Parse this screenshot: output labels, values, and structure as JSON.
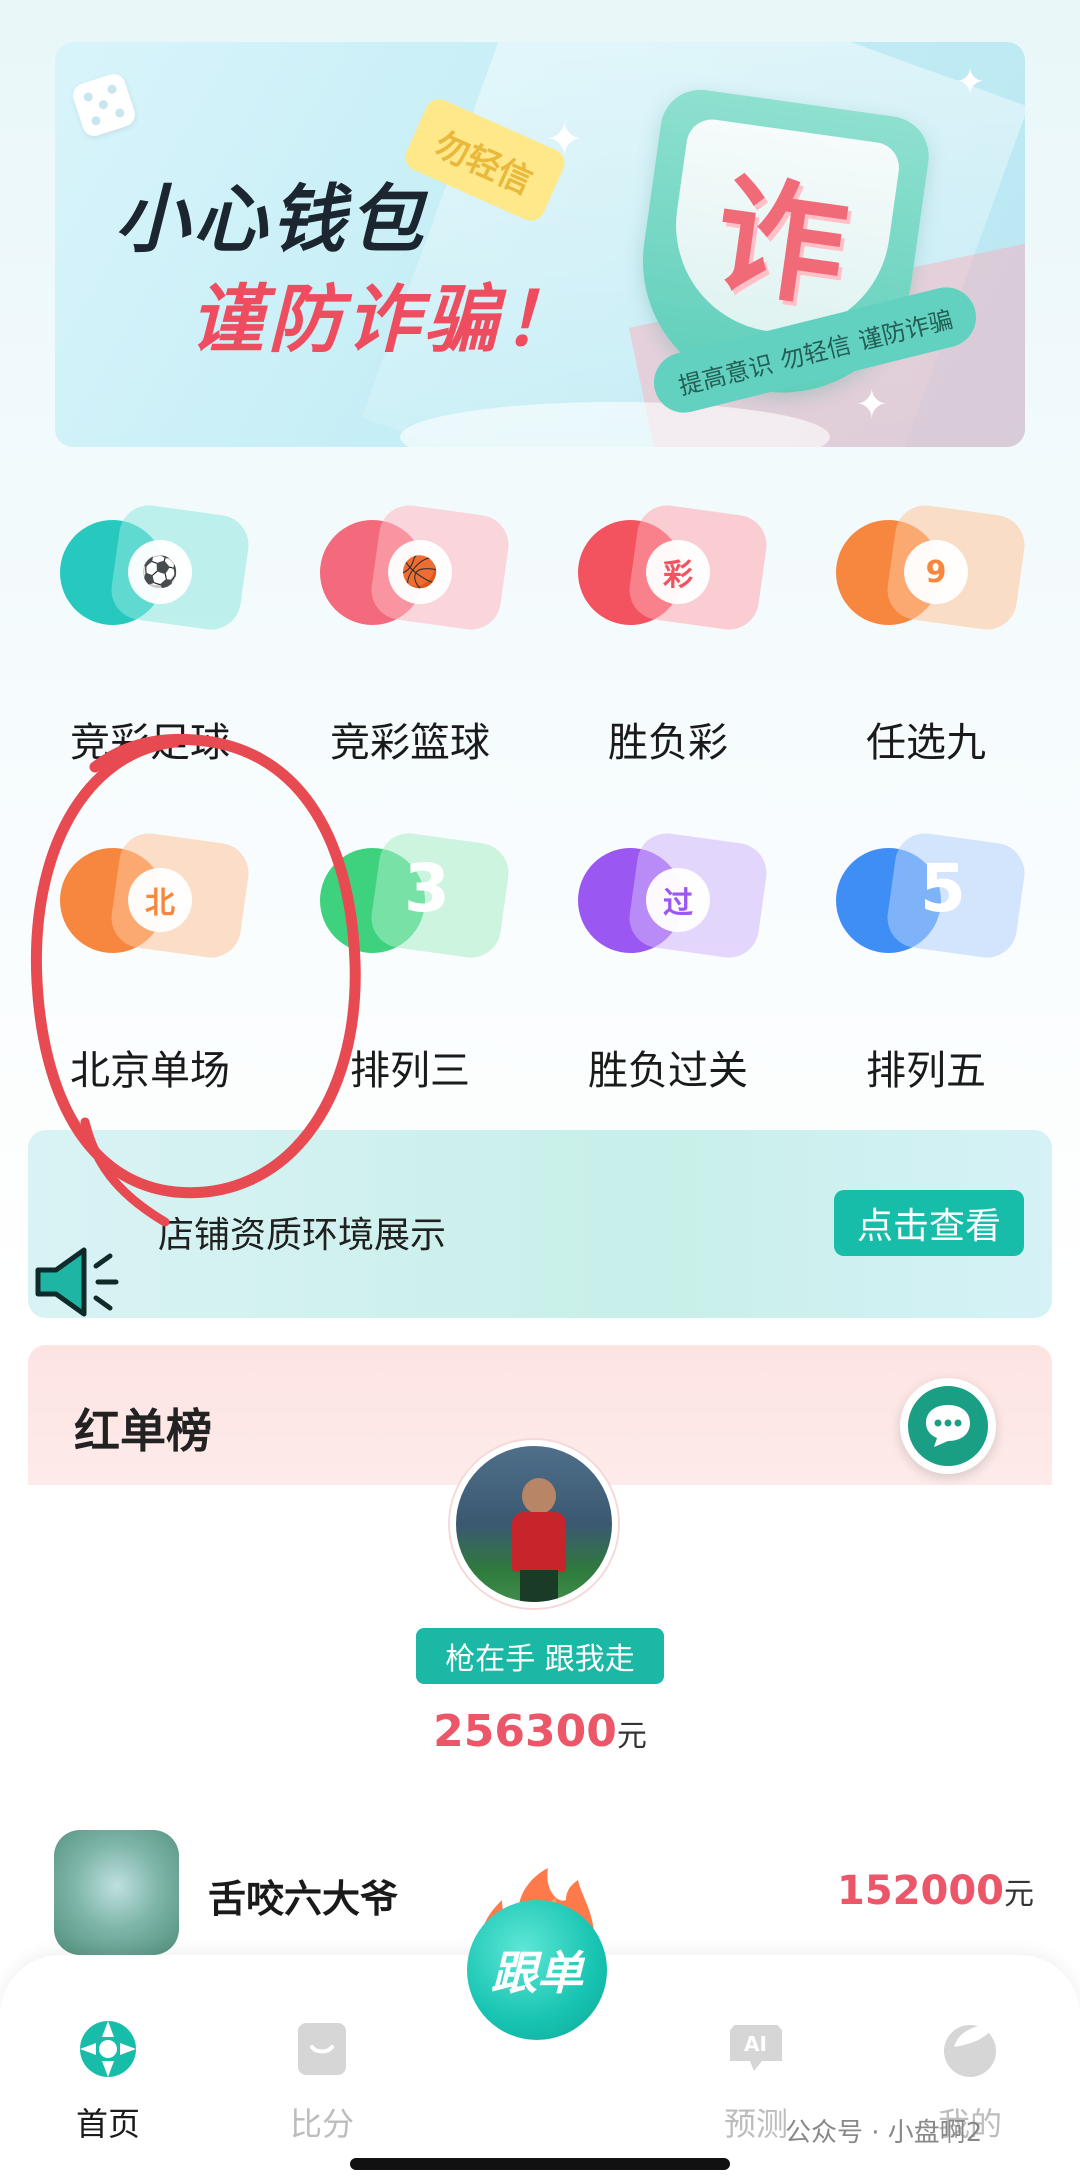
{
  "banner": {
    "title": "小心钱包",
    "subtitle": "谨防诈骗！",
    "tag": "勿轻信",
    "shield_char": "诈",
    "ribbon": [
      "提高意识",
      "勿轻信",
      "谨防诈骗"
    ]
  },
  "categories": [
    {
      "label": "竞彩足球",
      "glyph": "⚽",
      "color": "#27c9bf",
      "icon": "soccer-ball-icon"
    },
    {
      "label": "竞彩篮球",
      "glyph": "🏀",
      "color": "#f26a7b",
      "icon": "basketball-icon"
    },
    {
      "label": "胜负彩",
      "glyph": "彩",
      "color": "#f2535f",
      "icon": "cai-coin-icon"
    },
    {
      "label": "任选九",
      "glyph": "9",
      "color": "#f7863e",
      "icon": "nine-coin-icon"
    },
    {
      "label": "北京单场",
      "glyph": "北",
      "color": "#f7863e",
      "icon": "bei-ball-icon"
    },
    {
      "label": "排列三",
      "glyph": "3",
      "color": "#3fd27e",
      "icon": "three-icon"
    },
    {
      "label": "胜负过关",
      "glyph": "过",
      "color": "#9a57f2",
      "icon": "guo-ball-icon"
    },
    {
      "label": "排列五",
      "glyph": "5",
      "color": "#3e8ef5",
      "icon": "five-icon"
    }
  ],
  "notice": {
    "text": "店铺资质环境展示",
    "button": "点击查看"
  },
  "ranking": {
    "title": "红单榜",
    "top": {
      "motto": "枪在手 跟我走",
      "amount": "256300",
      "unit": "元"
    },
    "second": {
      "name": "舌咬六大爷",
      "amount": "152000",
      "unit": "元"
    }
  },
  "nav": {
    "items": [
      {
        "label": "首页",
        "icon": "home-icon",
        "active": true
      },
      {
        "label": "比分",
        "icon": "score-icon",
        "active": false
      },
      {
        "label": "预测",
        "icon": "ai-predict-icon",
        "active": false
      },
      {
        "label": "我的",
        "icon": "profile-icon",
        "active": false
      }
    ],
    "follow": "跟单"
  },
  "watermark": "公众号 · 小盘啊2",
  "colors": {
    "accent": "#17bda9",
    "amount": "#ec5669",
    "annotation": "#e84a52"
  }
}
